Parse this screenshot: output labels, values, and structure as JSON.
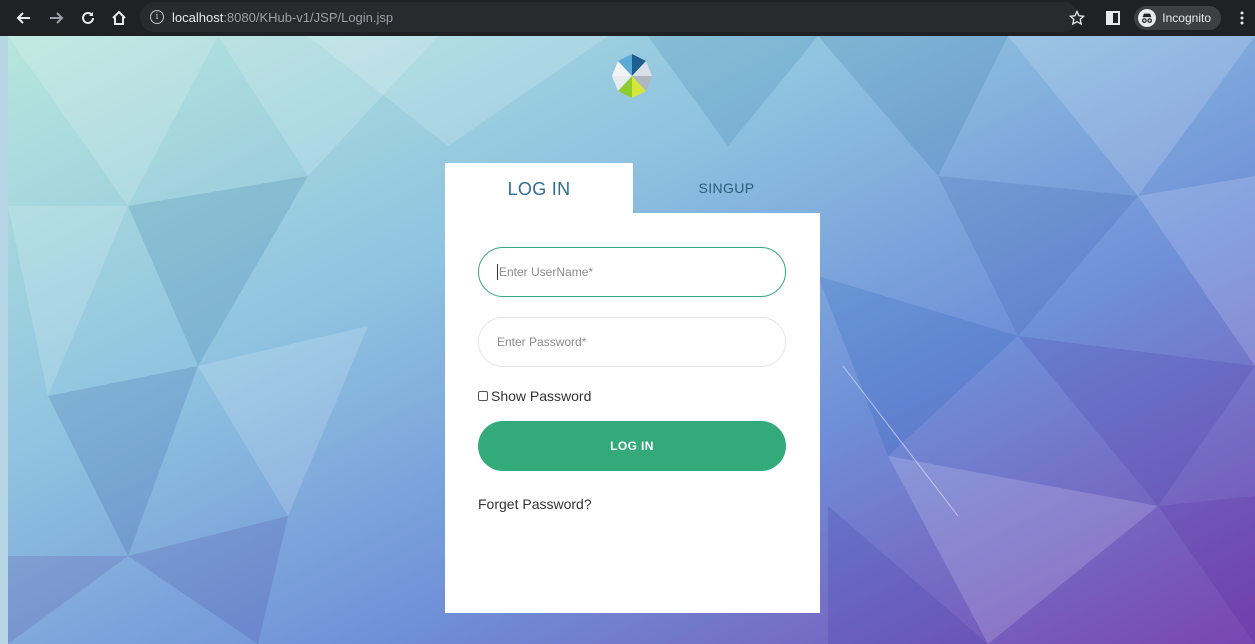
{
  "browser": {
    "url_host": "localhost",
    "url_path": ":8080/KHub-v1/JSP/Login.jsp",
    "incognito_label": "Incognito"
  },
  "icons": {
    "back": "back-arrow-icon",
    "forward": "forward-arrow-icon",
    "reload": "reload-icon",
    "home": "home-icon",
    "info": "info-icon",
    "bookmark": "star-icon",
    "side_panel": "side-panel-icon",
    "incognito": "incognito-icon",
    "menu": "kebab-menu-icon",
    "logo": "logo-icon"
  },
  "tabs": {
    "login": "LOG IN",
    "signup": "SINGUP"
  },
  "form": {
    "username_placeholder": "Enter UserName*",
    "password_placeholder": "Enter Password*",
    "show_password_label": "Show Password",
    "login_button": "LOG IN",
    "forget_link": "Forget Password?"
  },
  "colors": {
    "accent": "#33aa7a",
    "tab_text": "#2e6c95"
  }
}
